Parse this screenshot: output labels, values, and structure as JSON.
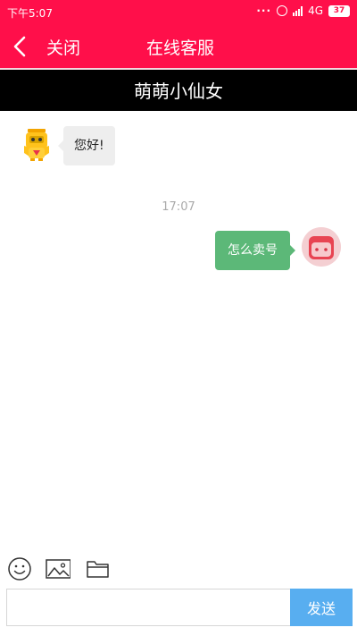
{
  "status_bar": {
    "time": "下午5:07",
    "network": "4G",
    "battery": "37"
  },
  "header": {
    "close_label": "关闭",
    "title": "在线客服"
  },
  "agent": {
    "name": "萌萌小仙女"
  },
  "messages": [
    {
      "from": "agent",
      "text": "您好!"
    },
    {
      "from": "user",
      "text": "怎么卖号"
    }
  ],
  "timestamp": "17:07",
  "composer": {
    "input_value": "",
    "send_label": "发送"
  },
  "colors": {
    "header": "#ff0f4a",
    "name_bar": "#000000",
    "out_bubble": "#5cb878",
    "in_bubble": "#eeeeee",
    "send": "#58aef0"
  },
  "icons": [
    "back-icon",
    "emoji-icon",
    "image-icon",
    "folder-icon"
  ]
}
